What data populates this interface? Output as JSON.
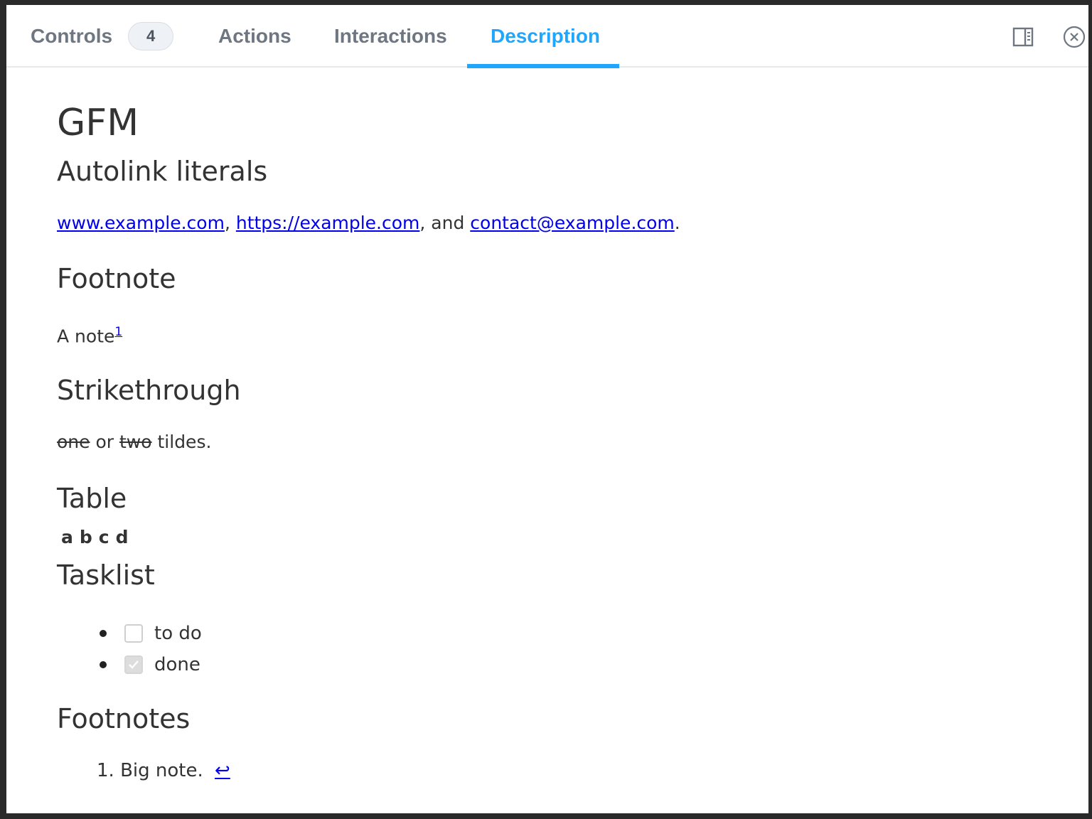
{
  "tabs": [
    {
      "label": "Controls",
      "badge": "4"
    },
    {
      "label": "Actions"
    },
    {
      "label": "Interactions"
    },
    {
      "label": "Description"
    }
  ],
  "active_tab": "Description",
  "toolbar": {
    "panel_toggle_icon": "sidebar-toggle-icon",
    "close_icon": "close-circle-icon"
  },
  "doc": {
    "title": "GFM",
    "autolink": {
      "heading": "Autolink literals",
      "link1": "www.example.com",
      "sep1": ", ",
      "link2": "https://example.com",
      "sep2": ", and ",
      "link3": "contact@example.com",
      "end": "."
    },
    "footnote": {
      "heading": "Footnote",
      "text": "A note",
      "ref": "1"
    },
    "strikethrough": {
      "heading": "Strikethrough",
      "s1": "one",
      "mid": " or ",
      "s2": "two",
      "end": " tildes."
    },
    "table": {
      "heading": "Table",
      "headers": [
        "a",
        "b",
        "c",
        "d"
      ]
    },
    "tasklist": {
      "heading": "Tasklist",
      "items": [
        {
          "label": "to do",
          "checked": false
        },
        {
          "label": "done",
          "checked": true
        }
      ]
    },
    "footnotes": {
      "heading": "Footnotes",
      "items": [
        {
          "number": "1.",
          "text": "Big note.",
          "backref": "↩"
        }
      ]
    }
  },
  "colors": {
    "accent": "#1ea7fd",
    "link": "#0000ee",
    "text": "#333333",
    "tab_inactive": "#6e7681"
  }
}
